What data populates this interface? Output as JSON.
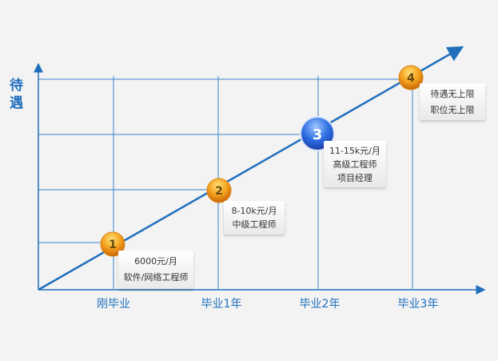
{
  "y_axis_label": [
    "待",
    "遇"
  ],
  "x_labels": [
    "刚毕业",
    "毕业1年",
    "毕业2年",
    "毕业3年"
  ],
  "stages": [
    {
      "number": "1",
      "lines": [
        "6000元/月",
        "软件/网络工程师"
      ],
      "style": "orange"
    },
    {
      "number": "2",
      "lines": [
        "8-10k元/月",
        "中级工程师"
      ],
      "style": "orange"
    },
    {
      "number": "3",
      "lines": [
        "11-15k元/月",
        "高级工程师",
        "项目经理"
      ],
      "style": "blue"
    },
    {
      "number": "4",
      "lines": [
        "待遇无上限",
        "职位无上限"
      ],
      "style": "orange"
    }
  ],
  "colors": {
    "line": "#1f6fbd",
    "grid": "#3a86cf",
    "orange": "#f0a020",
    "blue": "#2e6fe0"
  }
}
